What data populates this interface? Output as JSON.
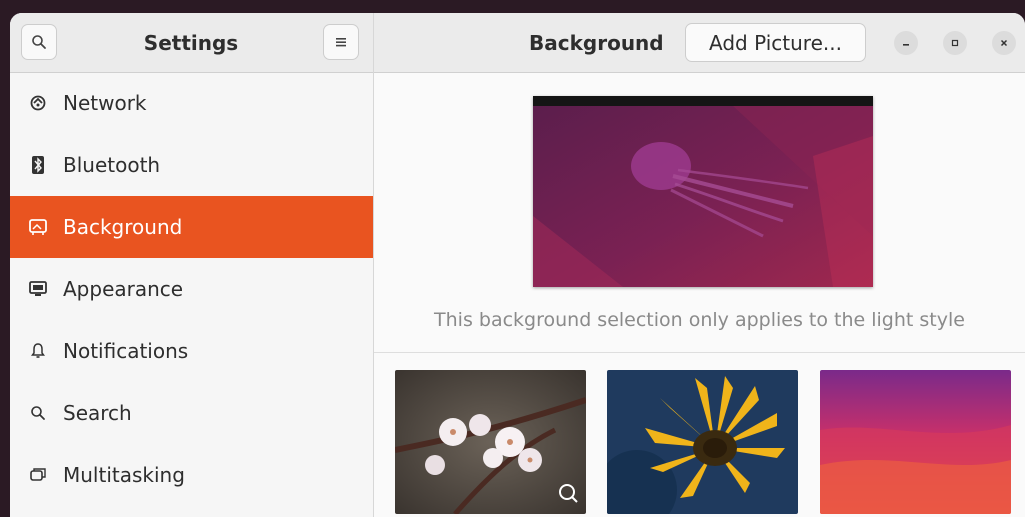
{
  "sidebar": {
    "search_icon": "search-icon",
    "title": "Settings",
    "menu_icon": "hamburger-menu-icon",
    "items": [
      {
        "label": "Network",
        "icon": "network-icon"
      },
      {
        "label": "Bluetooth",
        "icon": "bluetooth-icon"
      },
      {
        "label": "Background",
        "icon": "background-icon",
        "active": true
      },
      {
        "label": "Appearance",
        "icon": "appearance-icon"
      },
      {
        "label": "Notifications",
        "icon": "bell-icon"
      },
      {
        "label": "Search",
        "icon": "search-icon"
      },
      {
        "label": "Multitasking",
        "icon": "multitasking-icon"
      }
    ]
  },
  "header": {
    "title": "Background",
    "add_button_label": "Add Picture...",
    "window_controls": [
      "minimize-icon",
      "maximize-icon",
      "close-icon"
    ]
  },
  "main": {
    "caption": "This background selection only applies to the light style",
    "wallpapers": [
      "cherry-blossom",
      "sunflower",
      "purple-orange-gradient"
    ]
  },
  "colors": {
    "accent": "#e95420",
    "sidebar_bg": "#f6f6f6",
    "header_bg": "#ebebeb"
  }
}
